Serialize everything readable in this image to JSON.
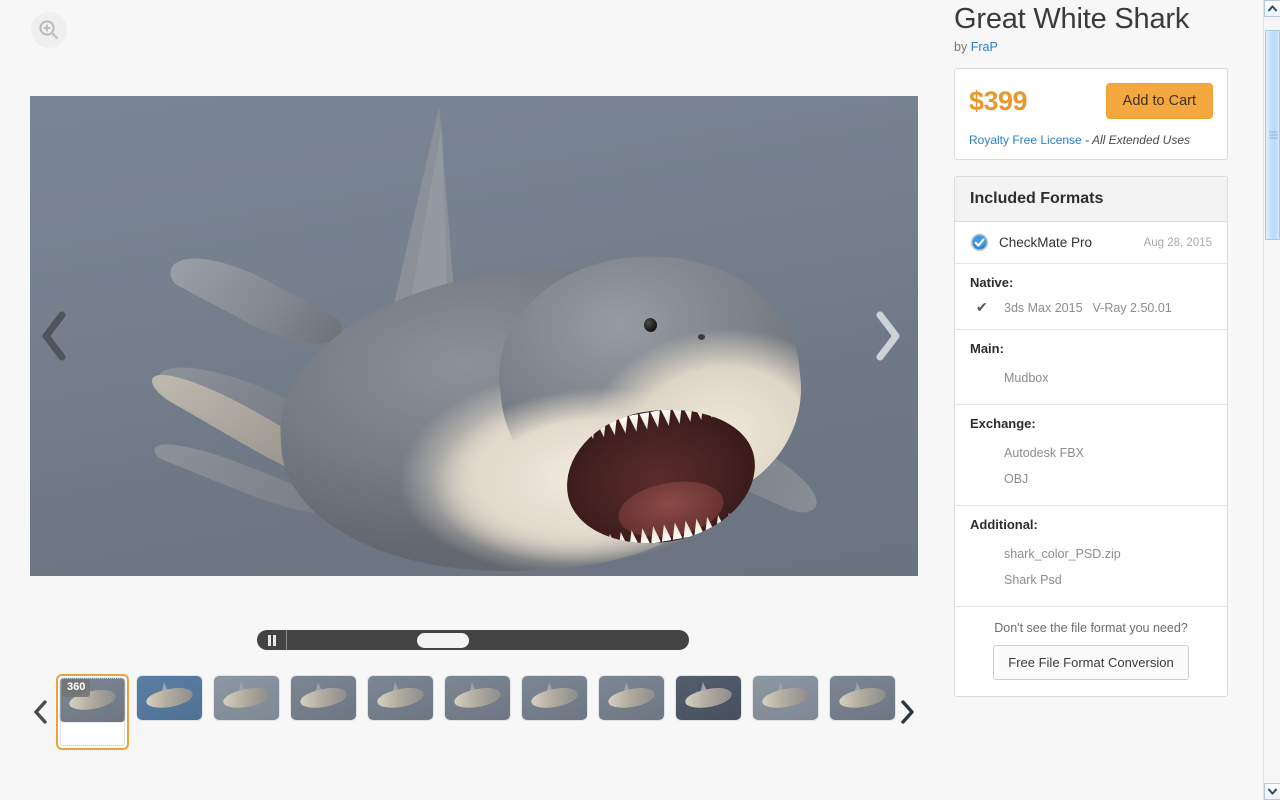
{
  "viewer": {
    "zoom_icon": "magnifier-plus-icon",
    "prev_label": "‹",
    "next_label": "›",
    "playback": {
      "pause_icon": "pause-icon",
      "state": "playing"
    },
    "strip": {
      "prev_label": "‹",
      "next_label": "›",
      "selected_index": 0,
      "badge": "360",
      "thumbnails": [
        {
          "name": "thumb-360-turntable",
          "variant": "default",
          "badge": "360"
        },
        {
          "name": "thumb-shark-top-blue",
          "variant": "alt",
          "badge": ""
        },
        {
          "name": "thumb-shark-side-pale",
          "variant": "pale",
          "badge": ""
        },
        {
          "name": "thumb-shark-front-left",
          "variant": "default",
          "badge": ""
        },
        {
          "name": "thumb-shark-mouth-open",
          "variant": "default",
          "badge": ""
        },
        {
          "name": "thumb-shark-mouth-closeup",
          "variant": "default",
          "badge": ""
        },
        {
          "name": "thumb-shark-profile",
          "variant": "default",
          "badge": ""
        },
        {
          "name": "thumb-shark-swimming",
          "variant": "default",
          "badge": ""
        },
        {
          "name": "thumb-shark-diagonal-dark",
          "variant": "dark",
          "badge": ""
        },
        {
          "name": "thumb-shark-jaws",
          "variant": "pale",
          "badge": ""
        },
        {
          "name": "thumb-shark-side-right",
          "variant": "default",
          "badge": ""
        },
        {
          "name": "thumb-shark-partial",
          "variant": "default",
          "badge": ""
        }
      ]
    }
  },
  "sidebar": {
    "title": "Great White Shark",
    "by_prefix": "by",
    "author": "FraP",
    "buy": {
      "price": "$399",
      "add_to_cart_label": "Add to Cart",
      "license_link": "Royalty Free License",
      "license_note": "- All Extended Uses"
    },
    "formats": {
      "heading": "Included Formats",
      "checkmate": {
        "label": "CheckMate Pro",
        "date": "Aug 28, 2015",
        "icon": "checkmate-badge-icon"
      },
      "sections": [
        {
          "label": "Native:",
          "inline": true,
          "check_icon": "checkmark-icon",
          "items": [
            "3ds Max 2015",
            "V-Ray 2.50.01"
          ]
        },
        {
          "label": "Main:",
          "inline": false,
          "items": [
            "Mudbox"
          ]
        },
        {
          "label": "Exchange:",
          "inline": false,
          "items": [
            "Autodesk FBX",
            "OBJ"
          ]
        },
        {
          "label": "Additional:",
          "inline": false,
          "items": [
            "shark_color_PSD.zip",
            "Shark Psd"
          ]
        }
      ],
      "convert_question": "Don't see the file format you need?",
      "convert_button": "Free File Format Conversion"
    }
  },
  "scrollbar": {
    "up_icon": "chevron-up-icon",
    "down_icon": "chevron-down-icon"
  },
  "colors": {
    "accent_orange": "#f4a83f",
    "price_orange": "#e8982c",
    "link_blue": "#2a7fc9",
    "page_bg": "#f7f7f7"
  }
}
